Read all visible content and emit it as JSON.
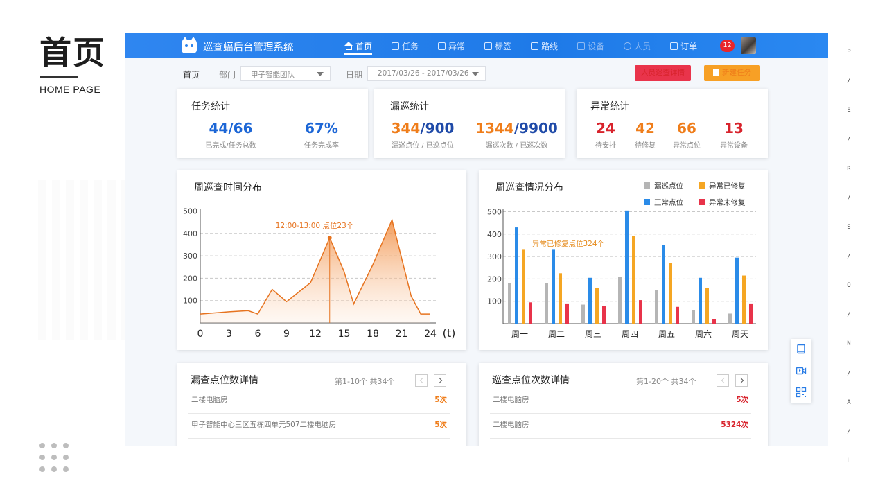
{
  "page": {
    "heading": "首页",
    "subheading": "HOME PAGE",
    "side_letters": [
      "P",
      "/",
      "E",
      "/",
      "R",
      "/",
      "S",
      "/",
      "O",
      "/",
      "N",
      "/",
      "A",
      "/",
      "L"
    ]
  },
  "app": {
    "title": "巡查蝠后台管理系统",
    "nav": [
      {
        "label": "首页",
        "icon": "home-icon",
        "active": true
      },
      {
        "label": "任务",
        "icon": "task-icon"
      },
      {
        "label": "异常",
        "icon": "alert-icon"
      },
      {
        "label": "标签",
        "icon": "tag-icon"
      },
      {
        "label": "路线",
        "icon": "route-icon"
      },
      {
        "label": "设备",
        "icon": "device-icon",
        "dim": true
      },
      {
        "label": "人员",
        "icon": "user-icon",
        "dim": true
      },
      {
        "label": "订单",
        "icon": "order-icon"
      }
    ],
    "notification_count": "12"
  },
  "filters": {
    "breadcrumb": "首页",
    "dept_label": "部门",
    "dept_value": "甲子智能团队",
    "date_label": "日期",
    "date_value": "2017/03/26 - 2017/03/26",
    "btn_detail": "人员巡查详情",
    "btn_new": "新建任务"
  },
  "task_stats": {
    "title": "任务统计",
    "items": [
      {
        "value": "44/66",
        "label": "已完成/任务总数"
      },
      {
        "value": "67%",
        "label": "任务完成率"
      }
    ]
  },
  "miss_stats": {
    "title": "漏巡统计",
    "items": [
      {
        "value_a": "344",
        "value_b": "/900",
        "label": "漏巡点位 / 已巡点位"
      },
      {
        "value_a": "1344",
        "value_b": "/9900",
        "label": "漏巡次数 / 已巡次数"
      }
    ]
  },
  "abnormal_stats": {
    "title": "异常统计",
    "items": [
      {
        "value": "24",
        "label": "待安排",
        "color": "#d8232c"
      },
      {
        "value": "42",
        "label": "待修复",
        "color": "#ef7d1a"
      },
      {
        "value": "66",
        "label": "异常点位",
        "color": "#ef7d1a"
      },
      {
        "value": "13",
        "label": "异常设备",
        "color": "#d8232c"
      }
    ]
  },
  "chart_data": [
    {
      "type": "area",
      "title": "周巡查时间分布",
      "x_unit": "(t)",
      "x": [
        0,
        3,
        5,
        6,
        7.5,
        9,
        11.5,
        13.5,
        15,
        16,
        18,
        20,
        22,
        23,
        24
      ],
      "y": [
        40,
        50,
        55,
        40,
        150,
        95,
        180,
        380,
        230,
        85,
        260,
        460,
        120,
        40,
        40
      ],
      "xticks": [
        0,
        3,
        6,
        9,
        12,
        15,
        18,
        21,
        24
      ],
      "yticks": [
        100,
        200,
        300,
        400,
        500
      ],
      "ylim": [
        0,
        520
      ],
      "xlim": [
        0,
        24
      ],
      "annotation": {
        "text": "12:00-13:00 点位23个",
        "x": 13.5,
        "y": 380
      },
      "color": "#e6731f"
    },
    {
      "type": "bar",
      "title": "周巡查情况分布",
      "categories": [
        "周一",
        "周二",
        "周三",
        "周四",
        "周五",
        "周六",
        "周天"
      ],
      "yticks": [
        100,
        200,
        300,
        400,
        500
      ],
      "ylim": [
        0,
        520
      ],
      "series": [
        {
          "name": "漏巡点位",
          "color": "#b5b5b5",
          "values": [
            180,
            180,
            85,
            210,
            150,
            60,
            45
          ]
        },
        {
          "name": "正常点位",
          "color": "#2a8be8",
          "values": [
            430,
            330,
            205,
            505,
            350,
            205,
            295
          ]
        },
        {
          "name": "异常已修复",
          "color": "#f5a623",
          "values": [
            330,
            225,
            160,
            390,
            270,
            160,
            215
          ]
        },
        {
          "name": "异常未修复",
          "color": "#e8334a",
          "values": [
            95,
            90,
            80,
            105,
            75,
            20,
            90
          ]
        }
      ],
      "annotation": {
        "text": "异常已修复点位324个"
      }
    }
  ],
  "miss_list": {
    "title": "漏查点位数详情",
    "pager": "第1-10个   共34个",
    "rows": [
      {
        "name": "二楼电脑房",
        "count": "5次"
      },
      {
        "name": "甲子智能中心三区五栋四单元507二楼电脑房",
        "count": "5次"
      }
    ]
  },
  "patrol_list": {
    "title": "巡查点位次数详情",
    "pager": "第1-20个   共34个",
    "rows": [
      {
        "name": "二楼电脑房",
        "count": "5次"
      },
      {
        "name": "二楼电脑房",
        "count": "5324次"
      }
    ]
  },
  "side_tools": [
    "book-icon",
    "video-icon",
    "qr-scan-icon"
  ]
}
